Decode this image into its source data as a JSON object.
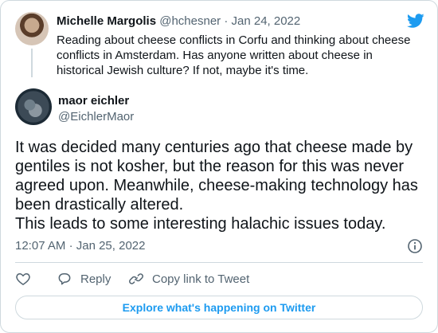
{
  "quoted_tweet": {
    "author_name": "Michelle Margolis",
    "author_handle": "@hchesner",
    "separator": "·",
    "date": "Jan 24, 2022",
    "text": "Reading about cheese conflicts in Corfu and thinking about cheese conflicts in Amsterdam. Has anyone written about cheese in historical Jewish culture?  If not, maybe it's time."
  },
  "main_tweet": {
    "author_name": "maor eichler",
    "author_handle": "@EichlerMaor",
    "text": "It was decided many centuries ago that cheese made by gentiles is not kosher, but the reason for this was never agreed upon. Meanwhile, cheese-making technology has been drastically altered.\nThis leads to some interesting halachic issues today.",
    "time": "12:07 AM",
    "separator": "·",
    "date": "Jan 25, 2022"
  },
  "actions": {
    "reply_label": "Reply",
    "copy_label": "Copy link to Tweet"
  },
  "explore_label": "Explore what's happening on Twitter",
  "colors": {
    "brand": "#1d9bf0",
    "text_primary": "#0f1419",
    "text_secondary": "#536471",
    "border": "#cfd9de"
  },
  "icons": [
    "twitter-bird-icon",
    "info-icon",
    "heart-icon",
    "reply-icon",
    "link-icon"
  ]
}
